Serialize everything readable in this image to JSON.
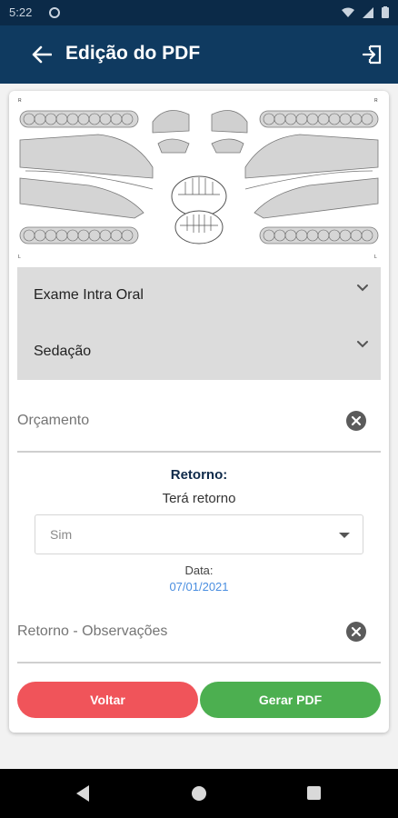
{
  "status_bar": {
    "time": "5:22"
  },
  "app_bar": {
    "title": "Edição do PDF"
  },
  "chart": {
    "left_markers": [
      "R",
      "L"
    ],
    "right_markers": [
      "R",
      "L"
    ]
  },
  "expand_items": [
    {
      "label": "Exame Intra Oral"
    },
    {
      "label": "Sedação"
    }
  ],
  "orcamento_field": {
    "label": "Orçamento"
  },
  "retorno": {
    "title": "Retorno:",
    "subtitle": "Terá retorno",
    "select_value": "Sim",
    "date_label": "Data:",
    "date_value": "07/01/2021"
  },
  "observacoes_field": {
    "label": "Retorno - Observações"
  },
  "buttons": {
    "voltar": "Voltar",
    "gerar_pdf": "Gerar PDF"
  },
  "colors": {
    "app_bar": "#0f3a60",
    "status_bar": "#0b2a48",
    "voltar_button": "#f0545a",
    "gerar_button": "#4caf50",
    "date_link": "#4a8ee0"
  }
}
